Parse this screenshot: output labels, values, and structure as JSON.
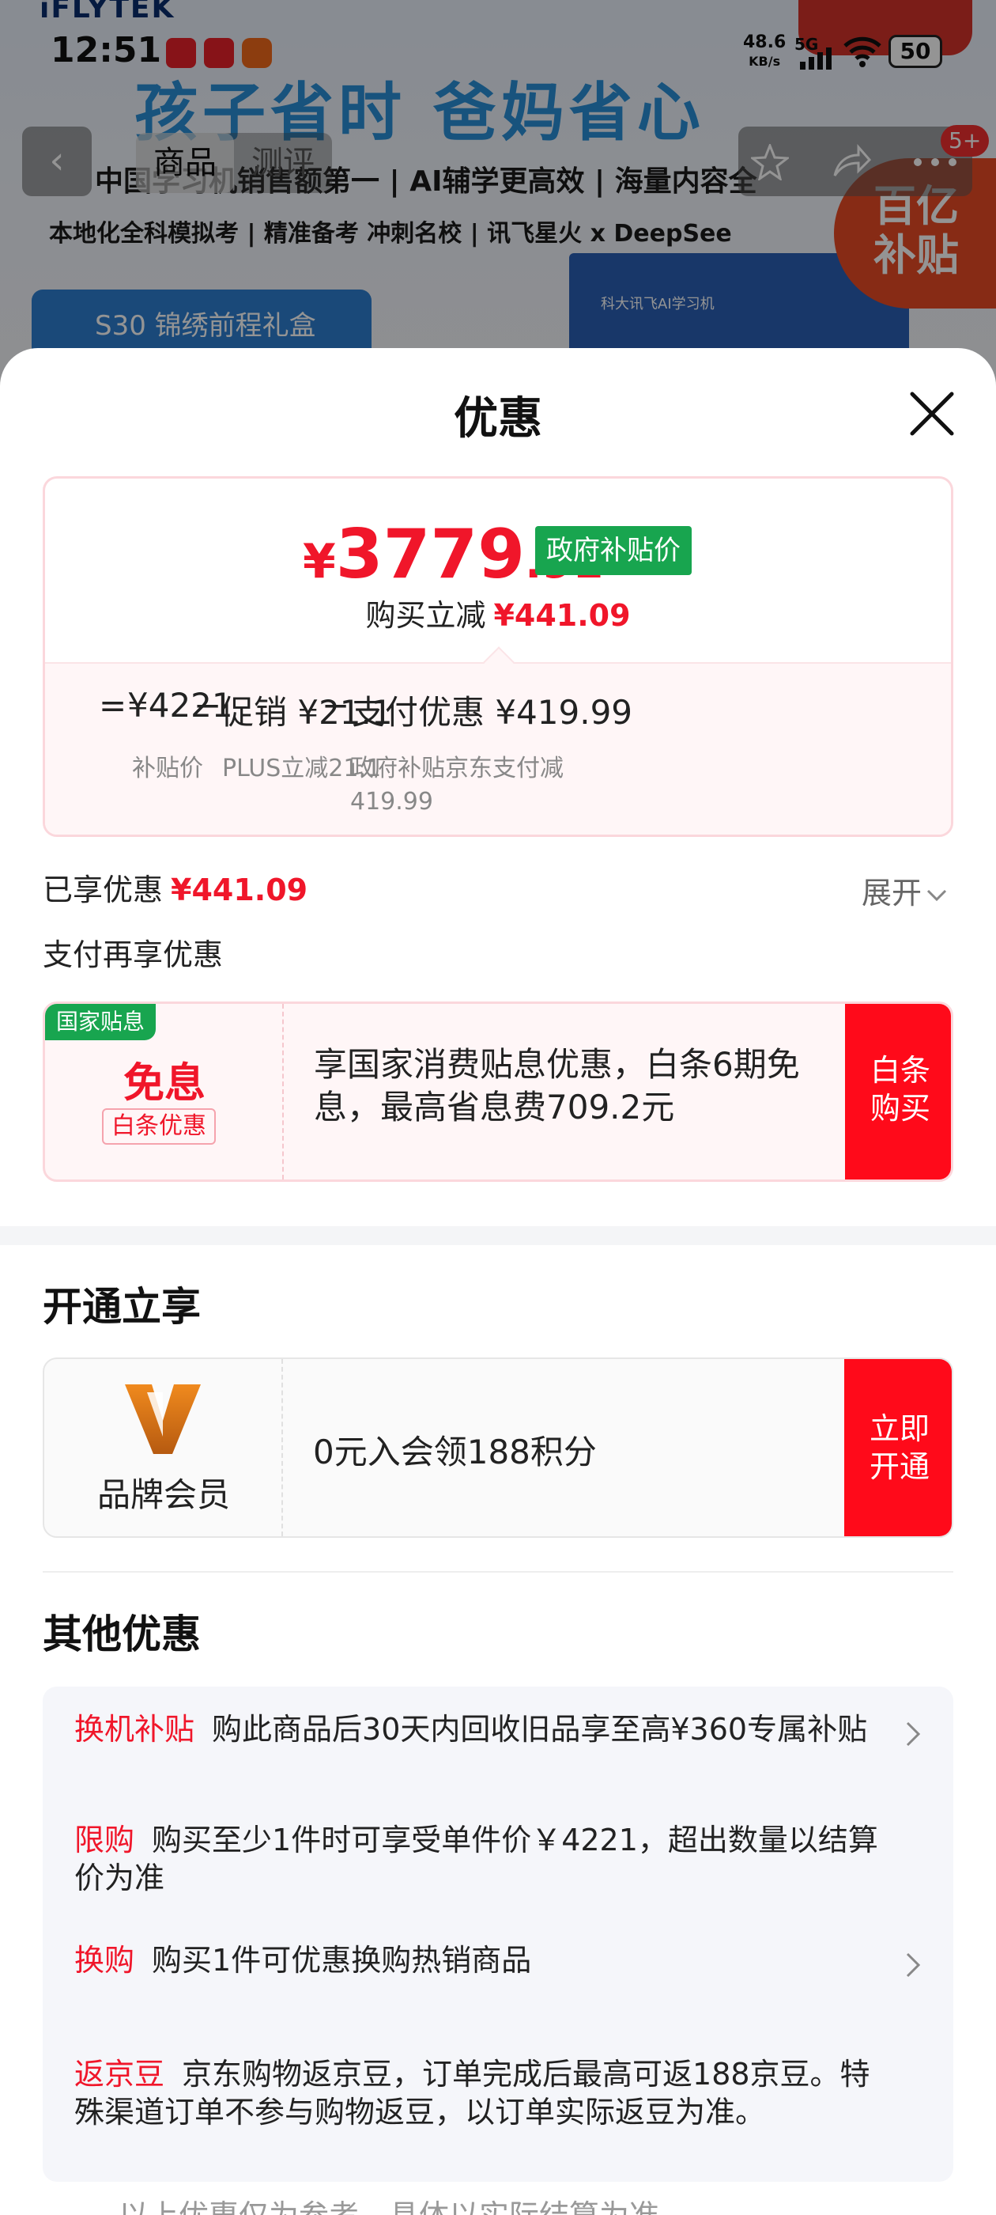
{
  "status_bar": {
    "time": "12:51",
    "net_speed_value": "48.6",
    "net_speed_unit": "KB/s",
    "network": "5G",
    "battery": "50"
  },
  "background": {
    "logo": "iFLYTEK",
    "headline": "孩子省时 爸妈省心",
    "line1": "中国学习机销售额第一 | AI辅学更高效 | 海量内容全",
    "line2": "本地化全科模拟考 | 精准备考 冲刺名校 | 讯飞星火 x DeepSee",
    "gift_box": "S30 锦绣前程礼盒",
    "product_box_label": "科大讯飞AI学习机",
    "subsidy_badge_line1": "百亿",
    "subsidy_badge_line2": "补贴"
  },
  "nav": {
    "tabs": [
      "商品",
      "测评"
    ],
    "badge": "5+"
  },
  "sheet": {
    "title": "优惠",
    "price": {
      "currency": "¥",
      "integer": "3779",
      "decimal": ".91",
      "tag": "政府补贴价",
      "instant_label": "购买立减",
      "instant_value": "¥441.09"
    },
    "formula": {
      "equals": "=",
      "base_value": "¥4221",
      "base_label": "补贴价",
      "minus1": "−",
      "promo_value": "促销 ¥21.1",
      "promo_label": "PLUS立减21.1",
      "minus2": "−",
      "pay_value": "支付优惠 ¥419.99",
      "pay_label_line1": "政府补贴京东支付减",
      "pay_label_line2": "419.99"
    },
    "enjoyed_label": "已享优惠",
    "enjoyed_value": "¥441.09",
    "expand_label": "展开",
    "pay_more_label": "支付再享优惠",
    "interest_card": {
      "tag": "国家贴息",
      "title": "免息",
      "sub_tag": "白条优惠",
      "text": "享国家消费贴息优惠，白条6期免息，最高省息费709.2元",
      "button_line1": "白条",
      "button_line2": "购买"
    },
    "open_section_title": "开通立享",
    "member_card": {
      "label": "品牌会员",
      "text": "0元入会领188积分",
      "button_line1": "立即",
      "button_line2": "开通"
    },
    "other_section_title": "其他优惠",
    "other_items": [
      {
        "tag": "换机补贴",
        "text": "购此商品后30天内回收旧品享至高¥360专属补贴"
      },
      {
        "tag": "限购",
        "text": "购买至少1件时可享受单件价￥4221，超出数量以结算价为准"
      },
      {
        "tag": "换购",
        "text": "购买1件可优惠换购热销商品"
      },
      {
        "tag": "返京豆",
        "text": "京东购物返京豆，订单完成后最高可返188京豆。特殊渠道订单不参与购物返豆，以订单实际返豆为准。"
      }
    ],
    "bottom_hint": "以上优惠仅为参考，具体以实际结算为准"
  },
  "colors": {
    "accent_red": "#f0162a",
    "button_red": "#ff0a1a",
    "gov_green": "#18a54f"
  }
}
